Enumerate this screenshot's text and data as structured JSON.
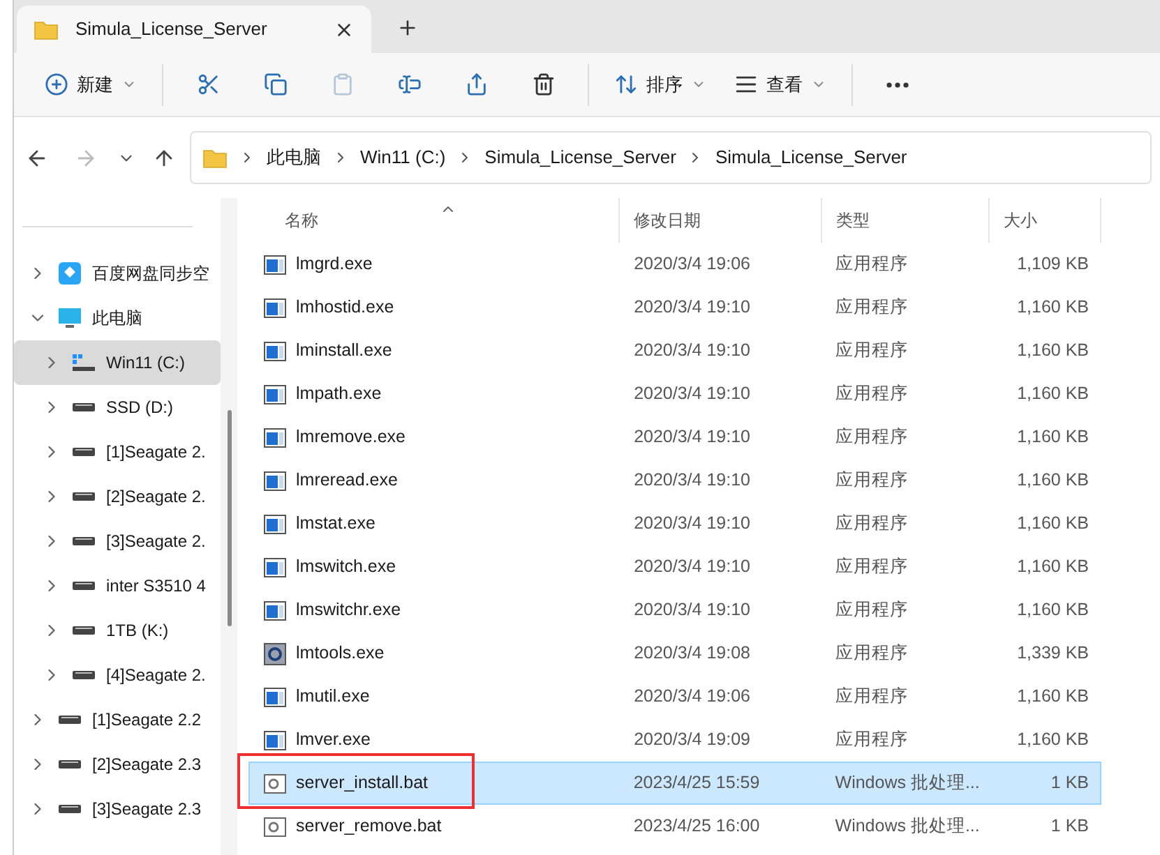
{
  "tab": {
    "title": "Simula_License_Server"
  },
  "toolbar": [
    {
      "kind": "new",
      "label": "新建",
      "disabled": false
    },
    {
      "kind": "cut",
      "disabled": false
    },
    {
      "kind": "copy",
      "disabled": false
    },
    {
      "kind": "paste",
      "disabled": true
    },
    {
      "kind": "rename",
      "disabled": false
    },
    {
      "kind": "share",
      "disabled": false
    },
    {
      "kind": "delete",
      "disabled": false
    },
    {
      "kind": "sort",
      "label": "排序",
      "disabled": false
    },
    {
      "kind": "view",
      "label": "查看",
      "disabled": false
    },
    {
      "kind": "more",
      "disabled": false
    }
  ],
  "nav": {
    "back_disabled": false,
    "forward_disabled": true
  },
  "breadcrumb": [
    "此电脑",
    "Win11 (C:)",
    "Simula_License_Server",
    "Simula_License_Server"
  ],
  "sidebar": [
    {
      "label": "百度网盘同步空",
      "kind": "cloud",
      "expanded": false,
      "selected": false
    },
    {
      "label": "此电脑",
      "kind": "pc",
      "expanded": true,
      "selected": false,
      "children": [
        {
          "label": "Win11 (C:)",
          "kind": "system",
          "expanded": false,
          "selected": true
        },
        {
          "label": "SSD (D:)",
          "kind": "drive",
          "expanded": false,
          "selected": false
        },
        {
          "label": "[1]Seagate 2.",
          "kind": "drive",
          "expanded": false,
          "selected": false
        },
        {
          "label": "[2]Seagate 2.",
          "kind": "drive",
          "expanded": false,
          "selected": false
        },
        {
          "label": "[3]Seagate 2.",
          "kind": "drive",
          "expanded": false,
          "selected": false
        },
        {
          "label": "inter S3510 4",
          "kind": "drive",
          "expanded": false,
          "selected": false
        },
        {
          "label": "1TB (K:)",
          "kind": "drive",
          "expanded": false,
          "selected": false
        },
        {
          "label": "[4]Seagate 2.",
          "kind": "drive",
          "expanded": false,
          "selected": false
        }
      ]
    },
    {
      "label": "[1]Seagate 2.2",
      "kind": "drive",
      "expanded": false,
      "selected": false
    },
    {
      "label": "[2]Seagate 2.3",
      "kind": "drive",
      "expanded": false,
      "selected": false
    },
    {
      "label": "[3]Seagate 2.3",
      "kind": "drive",
      "expanded": false,
      "selected": false
    }
  ],
  "columns": [
    "名称",
    "修改日期",
    "类型",
    "大小"
  ],
  "files": [
    {
      "name": "lmgrd.exe",
      "kind": "exe",
      "date": "2020/3/4 19:06",
      "type": "应用程序",
      "size": "1,109 KB",
      "selected": false,
      "highlighted": false
    },
    {
      "name": "lmhostid.exe",
      "kind": "exe",
      "date": "2020/3/4 19:10",
      "type": "应用程序",
      "size": "1,160 KB",
      "selected": false,
      "highlighted": false
    },
    {
      "name": "lminstall.exe",
      "kind": "exe",
      "date": "2020/3/4 19:10",
      "type": "应用程序",
      "size": "1,160 KB",
      "selected": false,
      "highlighted": false
    },
    {
      "name": "lmpath.exe",
      "kind": "exe",
      "date": "2020/3/4 19:10",
      "type": "应用程序",
      "size": "1,160 KB",
      "selected": false,
      "highlighted": false
    },
    {
      "name": "lmremove.exe",
      "kind": "exe",
      "date": "2020/3/4 19:10",
      "type": "应用程序",
      "size": "1,160 KB",
      "selected": false,
      "highlighted": false
    },
    {
      "name": "lmreread.exe",
      "kind": "exe",
      "date": "2020/3/4 19:10",
      "type": "应用程序",
      "size": "1,160 KB",
      "selected": false,
      "highlighted": false
    },
    {
      "name": "lmstat.exe",
      "kind": "exe",
      "date": "2020/3/4 19:10",
      "type": "应用程序",
      "size": "1,160 KB",
      "selected": false,
      "highlighted": false
    },
    {
      "name": "lmswitch.exe",
      "kind": "exe",
      "date": "2020/3/4 19:10",
      "type": "应用程序",
      "size": "1,160 KB",
      "selected": false,
      "highlighted": false
    },
    {
      "name": "lmswitchr.exe",
      "kind": "exe",
      "date": "2020/3/4 19:10",
      "type": "应用程序",
      "size": "1,160 KB",
      "selected": false,
      "highlighted": false
    },
    {
      "name": "lmtools.exe",
      "kind": "tool",
      "date": "2020/3/4 19:08",
      "type": "应用程序",
      "size": "1,339 KB",
      "selected": false,
      "highlighted": false
    },
    {
      "name": "lmutil.exe",
      "kind": "exe",
      "date": "2020/3/4 19:06",
      "type": "应用程序",
      "size": "1,160 KB",
      "selected": false,
      "highlighted": false
    },
    {
      "name": "lmver.exe",
      "kind": "exe",
      "date": "2020/3/4 19:09",
      "type": "应用程序",
      "size": "1,160 KB",
      "selected": false,
      "highlighted": false
    },
    {
      "name": "server_install.bat",
      "kind": "bat",
      "date": "2023/4/25 15:59",
      "type": "Windows 批处理...",
      "size": "1 KB",
      "selected": true,
      "highlighted": true
    },
    {
      "name": "server_remove.bat",
      "kind": "bat",
      "date": "2023/4/25 16:00",
      "type": "Windows 批处理...",
      "size": "1 KB",
      "selected": false,
      "highlighted": false
    }
  ]
}
